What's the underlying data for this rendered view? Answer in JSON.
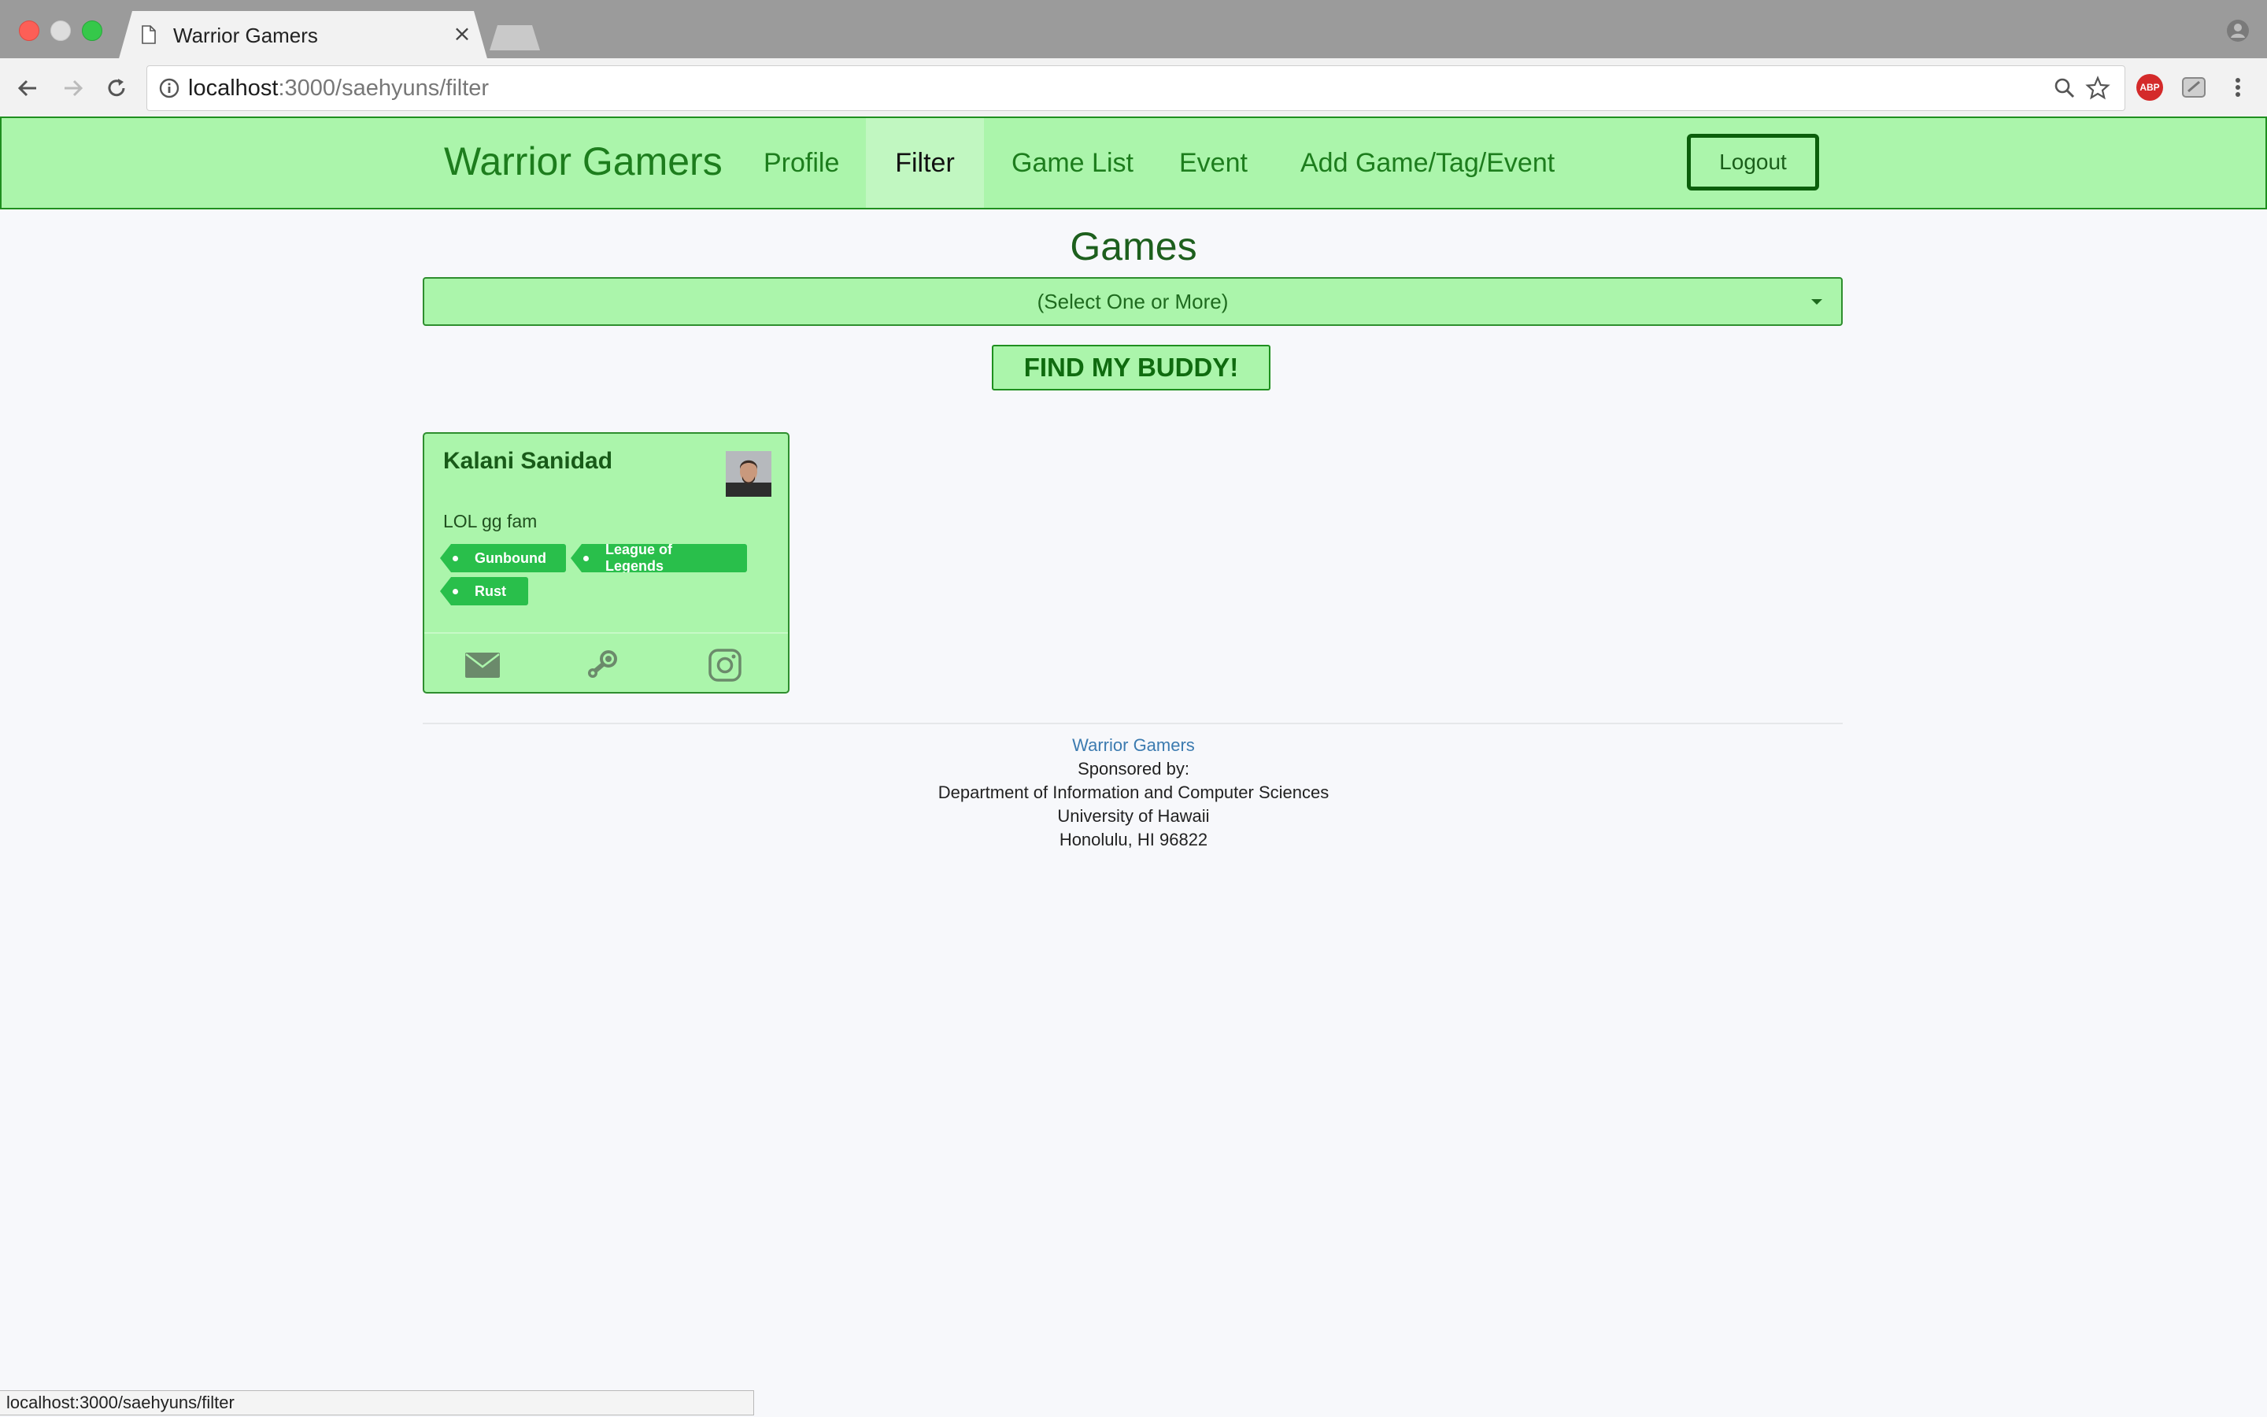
{
  "browser": {
    "tab_title": "Warrior Gamers",
    "url_host": "localhost",
    "url_path": ":3000/saehyuns/filter",
    "extension_label": "ABP",
    "status_url": "localhost:3000/saehyuns/filter"
  },
  "navbar": {
    "brand": "Warrior Gamers",
    "items": [
      {
        "label": "Profile",
        "active": false
      },
      {
        "label": "Filter",
        "active": true
      },
      {
        "label": "Game List",
        "active": false
      },
      {
        "label": "Event",
        "active": false
      },
      {
        "label": "Add Game/Tag/Event",
        "active": false
      }
    ],
    "logout_label": "Logout"
  },
  "filter": {
    "heading": "Games",
    "select_placeholder": "(Select One or More)",
    "find_button": "FIND MY BUDDY!"
  },
  "results": [
    {
      "name": "Kalani Sanidad",
      "description": "LOL gg fam",
      "tags": [
        "Gunbound",
        "League of Legends",
        "Rust"
      ],
      "icons": [
        "envelope-icon",
        "steam-icon",
        "instagram-icon"
      ]
    }
  ],
  "footer": {
    "site_link": "Warrior Gamers",
    "lines": [
      "Sponsored by:",
      "Department of Information and Computer Sciences",
      "University of Hawaii",
      "Honolulu, HI 96822"
    ]
  },
  "colors": {
    "accent_green": "#abf5ab",
    "dark_green": "#1d7d1d",
    "tag_green": "#29bf4b"
  }
}
